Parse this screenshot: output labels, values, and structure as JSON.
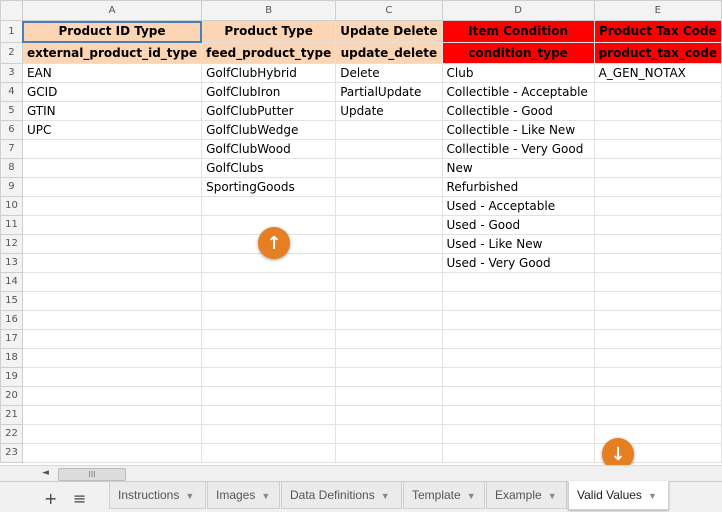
{
  "columns": [
    "A",
    "B",
    "C",
    "D",
    "E"
  ],
  "rows": [
    "1",
    "2",
    "3",
    "4",
    "5",
    "6",
    "7",
    "8",
    "9",
    "10",
    "11",
    "12",
    "13",
    "14",
    "15",
    "16",
    "17",
    "18",
    "19",
    "20",
    "21",
    "22",
    "23"
  ],
  "header_row1": [
    "Product ID Type",
    "Product Type",
    "Update Delete",
    "Item Condition",
    "Product Tax Code"
  ],
  "header_row2": [
    "external_product_id_type",
    "feed_product_type",
    "update_delete",
    "condition_type",
    "product_tax_code"
  ],
  "data_rows": [
    [
      "EAN",
      "GolfClubHybrid",
      "Delete",
      "Club",
      "A_GEN_NOTAX"
    ],
    [
      "GCID",
      "GolfClubIron",
      "PartialUpdate",
      "Collectible - Acceptable",
      ""
    ],
    [
      "GTIN",
      "GolfClubPutter",
      "Update",
      "Collectible - Good",
      ""
    ],
    [
      "UPC",
      "GolfClubWedge",
      "",
      "Collectible - Like New",
      ""
    ],
    [
      "",
      "GolfClubWood",
      "",
      "Collectible - Very Good",
      ""
    ],
    [
      "",
      "GolfClubs",
      "",
      "New",
      ""
    ],
    [
      "",
      "SportingGoods",
      "",
      "Refurbished",
      ""
    ],
    [
      "",
      "",
      "",
      "Used - Acceptable",
      ""
    ],
    [
      "",
      "",
      "",
      "Used - Good",
      ""
    ],
    [
      "",
      "",
      "",
      "Used - Like New",
      ""
    ],
    [
      "",
      "",
      "",
      "Used - Very Good",
      ""
    ]
  ],
  "colors": {
    "peach": "#fcd5b4",
    "red": "#ff0000",
    "fab": "#e67e22"
  },
  "icons": {
    "scroll_up": "arrow-up-icon",
    "scroll_down": "arrow-down-icon",
    "add_sheet": "plus-icon",
    "all_sheets": "list-icon"
  },
  "scroll": {
    "left_arrow": "◄",
    "thumb_grip": "III"
  },
  "tabbar": {
    "add_symbol": "+",
    "menu_symbol": "≡",
    "tabs": [
      {
        "label": "Instructions",
        "active": false
      },
      {
        "label": "Images",
        "active": false
      },
      {
        "label": "Data Definitions",
        "active": false
      },
      {
        "label": "Template",
        "active": false
      },
      {
        "label": "Example",
        "active": false
      },
      {
        "label": "Valid Values",
        "active": true
      }
    ]
  }
}
